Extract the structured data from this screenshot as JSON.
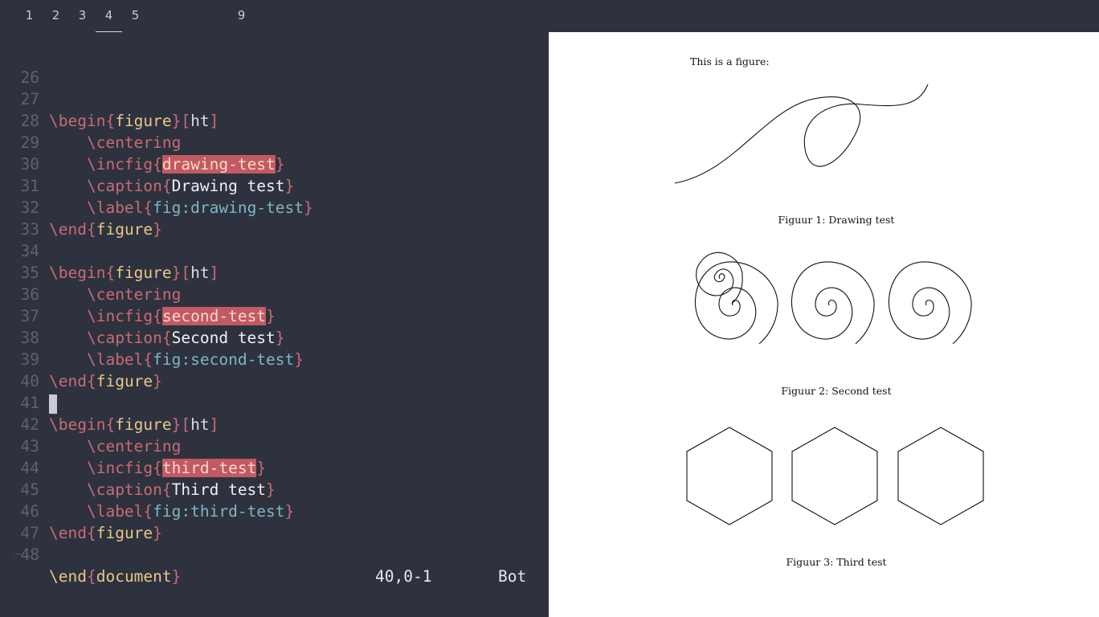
{
  "workspaces": {
    "items": [
      {
        "label": "1"
      },
      {
        "label": "2"
      },
      {
        "label": "3"
      },
      {
        "label": "4"
      },
      {
        "label": "5"
      },
      {
        "label": "9"
      }
    ],
    "active": "4"
  },
  "editor": {
    "lines": [
      {
        "n": "26"
      },
      {
        "n": "27"
      },
      {
        "n": "28"
      },
      {
        "n": "29"
      },
      {
        "n": "30"
      },
      {
        "n": "31"
      },
      {
        "n": "32"
      },
      {
        "n": "33"
      },
      {
        "n": "34"
      },
      {
        "n": "35"
      },
      {
        "n": "36"
      },
      {
        "n": "37"
      },
      {
        "n": "38"
      },
      {
        "n": "39"
      },
      {
        "n": "40"
      },
      {
        "n": "41"
      },
      {
        "n": "42"
      },
      {
        "n": "43"
      },
      {
        "n": "44"
      },
      {
        "n": "45"
      },
      {
        "n": "46"
      },
      {
        "n": "47"
      },
      {
        "n": "48"
      }
    ],
    "tokens": {
      "begin": "\\begin",
      "end": "\\end",
      "centering": "\\centering",
      "incfig": "\\incfig",
      "caption": "\\caption",
      "label": "\\label",
      "figure": "figure",
      "ht": "ht",
      "document": "document",
      "lbrace": "{",
      "rbrace": "}",
      "lbrack": "[",
      "rbrack": "]"
    },
    "figures": [
      {
        "file": "drawing-test",
        "caption": "Drawing test",
        "label": "fig:drawing-test"
      },
      {
        "file": "second-test",
        "caption": "Second test",
        "label": "fig:second-test"
      },
      {
        "file": "third-test",
        "caption": "Third test",
        "label": "fig:third-test"
      }
    ],
    "tilde": "~",
    "status": {
      "position": "40,0-1",
      "scroll": "Bot"
    }
  },
  "pdf": {
    "intro": "This is a figure:",
    "captions": [
      "Figuur 1:  Drawing test",
      "Figuur 2:  Second test",
      "Figuur 3:  Third test"
    ]
  },
  "colors": {
    "background": "#2e323e",
    "command": "#c86b76",
    "environment": "#e9c68a",
    "label": "#7fb6c4",
    "highlight": "#c15a63"
  }
}
